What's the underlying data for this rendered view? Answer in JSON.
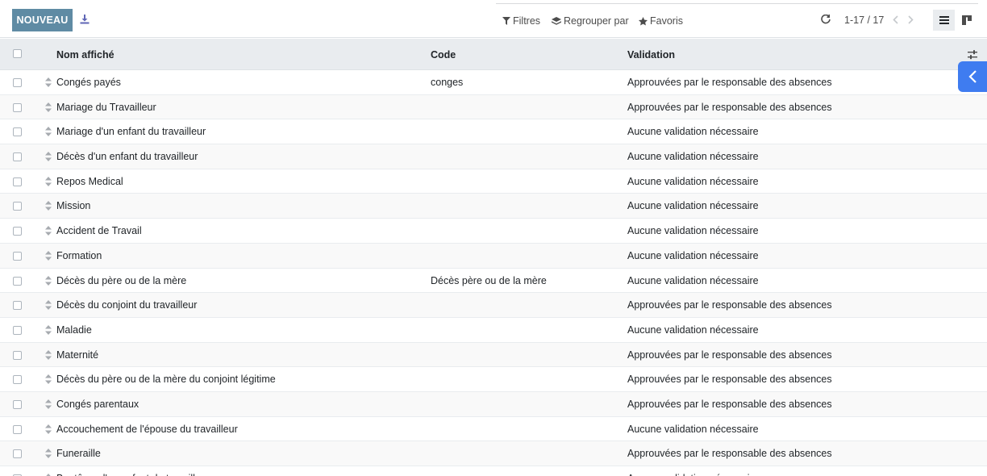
{
  "toolbar": {
    "new_label": "NOUVEAU",
    "filters_label": "Filtres",
    "groupby_label": "Regrouper par",
    "favorites_label": "Favoris",
    "pager_value": "1-17 / 17"
  },
  "icons": {
    "download": "download-icon",
    "filter": "filter-icon",
    "groupby": "layers-icon",
    "favorites": "star-icon",
    "refresh": "refresh-icon",
    "prev": "chevron-left-icon",
    "next": "chevron-right-icon",
    "list_view": "list-view-icon",
    "kanban_view": "kanban-view-icon",
    "optional_columns": "sliders-icon",
    "side_panel": "chevron-left-icon"
  },
  "colors": {
    "primary": "#5f8ba4",
    "accent": "#3f7cf0",
    "header_bg": "#e9ecef"
  },
  "columns": {
    "name": "Nom affiché",
    "code": "Code",
    "validation": "Validation"
  },
  "rows": [
    {
      "name": "Congés payés",
      "code": "conges",
      "validation": "Approuvées par le responsable des absences"
    },
    {
      "name": "Mariage du Travailleur",
      "code": "",
      "validation": "Approuvées par le responsable des absences"
    },
    {
      "name": "Mariage d'un enfant du travailleur",
      "code": "",
      "validation": "Aucune validation nécessaire"
    },
    {
      "name": "Décès d'un enfant du travailleur",
      "code": "",
      "validation": "Aucune validation nécessaire"
    },
    {
      "name": "Repos Medical",
      "code": "",
      "validation": "Aucune validation nécessaire"
    },
    {
      "name": "Mission",
      "code": "",
      "validation": "Aucune validation nécessaire"
    },
    {
      "name": "Accident de Travail",
      "code": "",
      "validation": "Aucune validation nécessaire"
    },
    {
      "name": "Formation",
      "code": "",
      "validation": "Aucune validation nécessaire"
    },
    {
      "name": "Décès du père ou de la mère",
      "code": "Décès père ou de la mère",
      "validation": "Aucune validation nécessaire"
    },
    {
      "name": "Décès du conjoint du travailleur",
      "code": "",
      "validation": "Approuvées par le responsable des absences"
    },
    {
      "name": "Maladie",
      "code": "",
      "validation": "Aucune validation nécessaire"
    },
    {
      "name": "Maternité",
      "code": "",
      "validation": "Approuvées par le responsable des absences"
    },
    {
      "name": "Décès du père ou de la mère du conjoint légitime",
      "code": "",
      "validation": "Approuvées par le responsable des absences"
    },
    {
      "name": "Congés parentaux",
      "code": "",
      "validation": "Approuvées par le responsable des absences"
    },
    {
      "name": "Accouchement de l'épouse du travailleur",
      "code": "",
      "validation": "Aucune validation nécessaire"
    },
    {
      "name": "Funeraille",
      "code": "",
      "validation": "Approuvées par le responsable des absences"
    },
    {
      "name": "Baptême d'un enfant du travailleur",
      "code": "",
      "validation": "Aucune validation nécessaire"
    }
  ]
}
